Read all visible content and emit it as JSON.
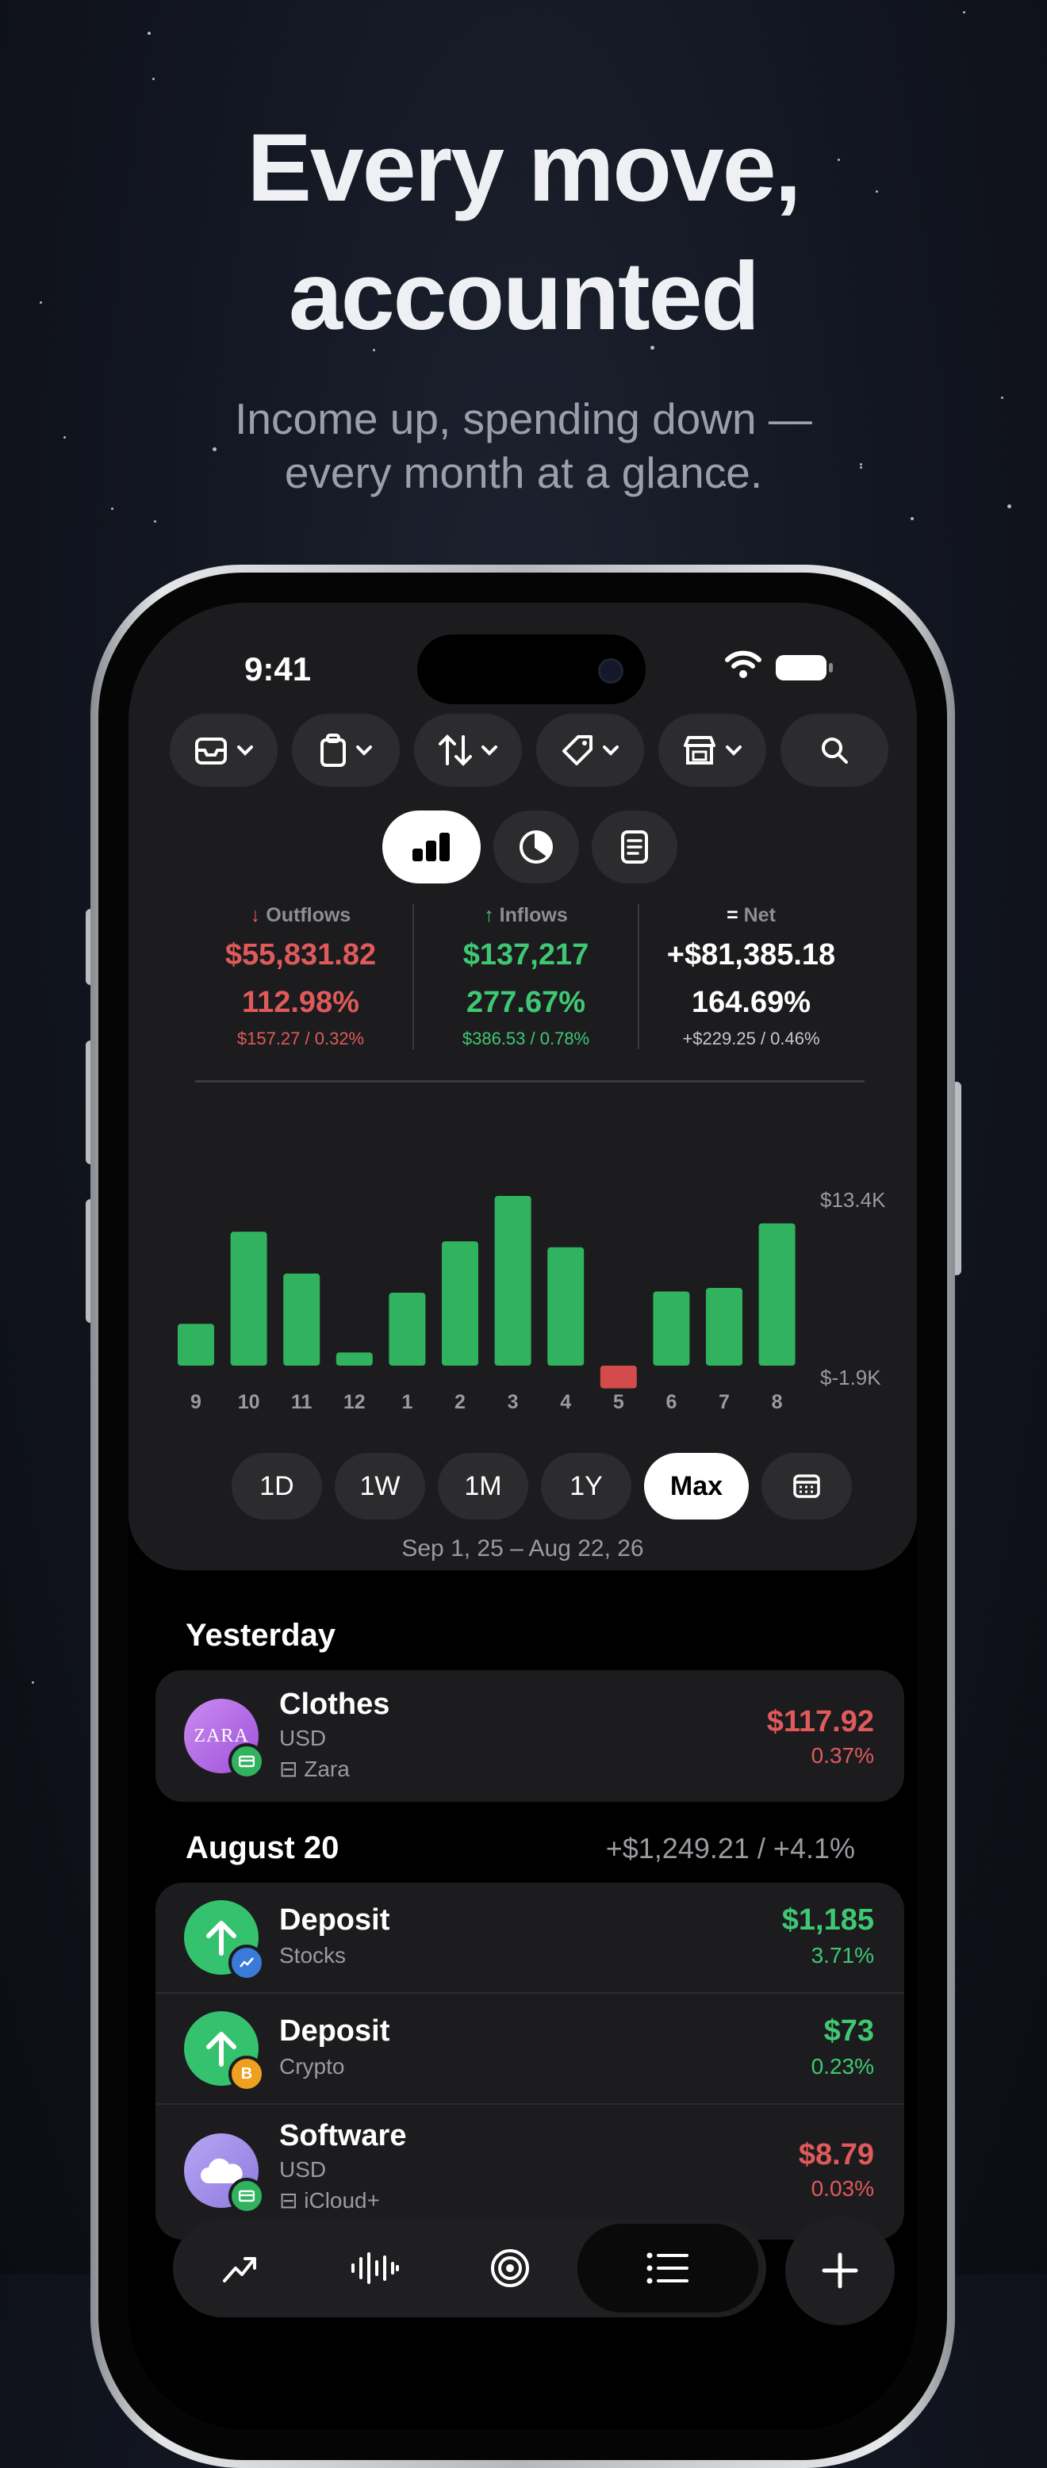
{
  "hero": {
    "title_line1": "Every move,",
    "title_line2": "accounted",
    "subtitle_line1": "Income up, spending down —",
    "subtitle_line2": "every month at a glance."
  },
  "status_bar": {
    "time": "9:41"
  },
  "filters": [
    "tray-icon",
    "clipboard-icon",
    "sort-arrows-icon",
    "tag-icon",
    "store-icon",
    "search-icon"
  ],
  "views": {
    "active": "bar-chart"
  },
  "stats": {
    "outflows": {
      "label": "Outflows",
      "amount": "$55,831.82",
      "percent": "112.98%",
      "detail": "$157.27 / 0.32%"
    },
    "inflows": {
      "label": "Inflows",
      "amount": "$137,217",
      "percent": "277.67%",
      "detail": "$386.53 / 0.78%"
    },
    "net": {
      "label": "Net",
      "amount": "+$81,385.18",
      "percent": "164.69%",
      "detail": "+$229.25 / 0.46%"
    }
  },
  "chart_data": {
    "type": "bar",
    "categories": [
      "9",
      "10",
      "11",
      "12",
      "1",
      "2",
      "3",
      "4",
      "5",
      "6",
      "7",
      "8"
    ],
    "values": [
      3.5,
      11.2,
      7.7,
      1.1,
      6.1,
      10.4,
      14.2,
      9.9,
      -1.9,
      6.2,
      6.5,
      11.9
    ],
    "ylim": [
      -1.9,
      13.4
    ],
    "y_tick_labels": [
      "$13.4K",
      "$-1.9K"
    ],
    "colors": {
      "positive": "#30b25e",
      "negative": "#d34b4b"
    },
    "grid": false
  },
  "ranges": {
    "items": [
      "1D",
      "1W",
      "1M",
      "1Y",
      "Max"
    ],
    "active": "Max",
    "date_range": "Sep 1, 25 – Aug 22, 26"
  },
  "sections": {
    "yesterday": {
      "title": "Yesterday",
      "rows": [
        {
          "title": "Clothes",
          "currency": "USD",
          "merchant": "Zara",
          "amount": "$117.92",
          "percent": "0.37%"
        }
      ]
    },
    "aug20": {
      "title": "August 20",
      "summary": "+$1,249.21 / +4.1%",
      "rows": [
        {
          "title": "Deposit",
          "sub": "Stocks",
          "amount": "$1,185",
          "percent": "3.71%"
        },
        {
          "title": "Deposit",
          "sub": "Crypto",
          "amount": "$73",
          "percent": "0.23%"
        },
        {
          "title": "Software",
          "sub": "USD",
          "merchant": "iCloud+",
          "amount": "$8.79",
          "percent": "0.03%"
        }
      ]
    }
  },
  "logos": {
    "zara": "ZARA"
  },
  "tabbar": [
    "trend-icon",
    "waveform-icon",
    "target-icon",
    "list-icon"
  ],
  "colors": {
    "outflow": "#e05a5a",
    "inflow": "#3fc873",
    "card": "#1c1c1e"
  }
}
